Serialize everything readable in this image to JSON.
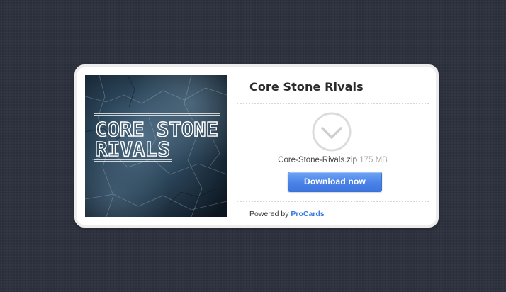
{
  "card": {
    "title": "Core Stone Rivals",
    "cover": {
      "line1": "CORE STONE",
      "line2": "RIVALS",
      "image": "icy-blue-stone-texture"
    },
    "icon": "chevron-down-circle-icon",
    "file_name": "Core-Stone-Rivals.zip",
    "file_size": "175 MB",
    "download_label": "Download now",
    "powered_prefix": "Powered by",
    "powered_link": "ProCards"
  },
  "colors": {
    "background": "#2f3340",
    "button": "#4a82e8",
    "link": "#3b7ce0"
  }
}
